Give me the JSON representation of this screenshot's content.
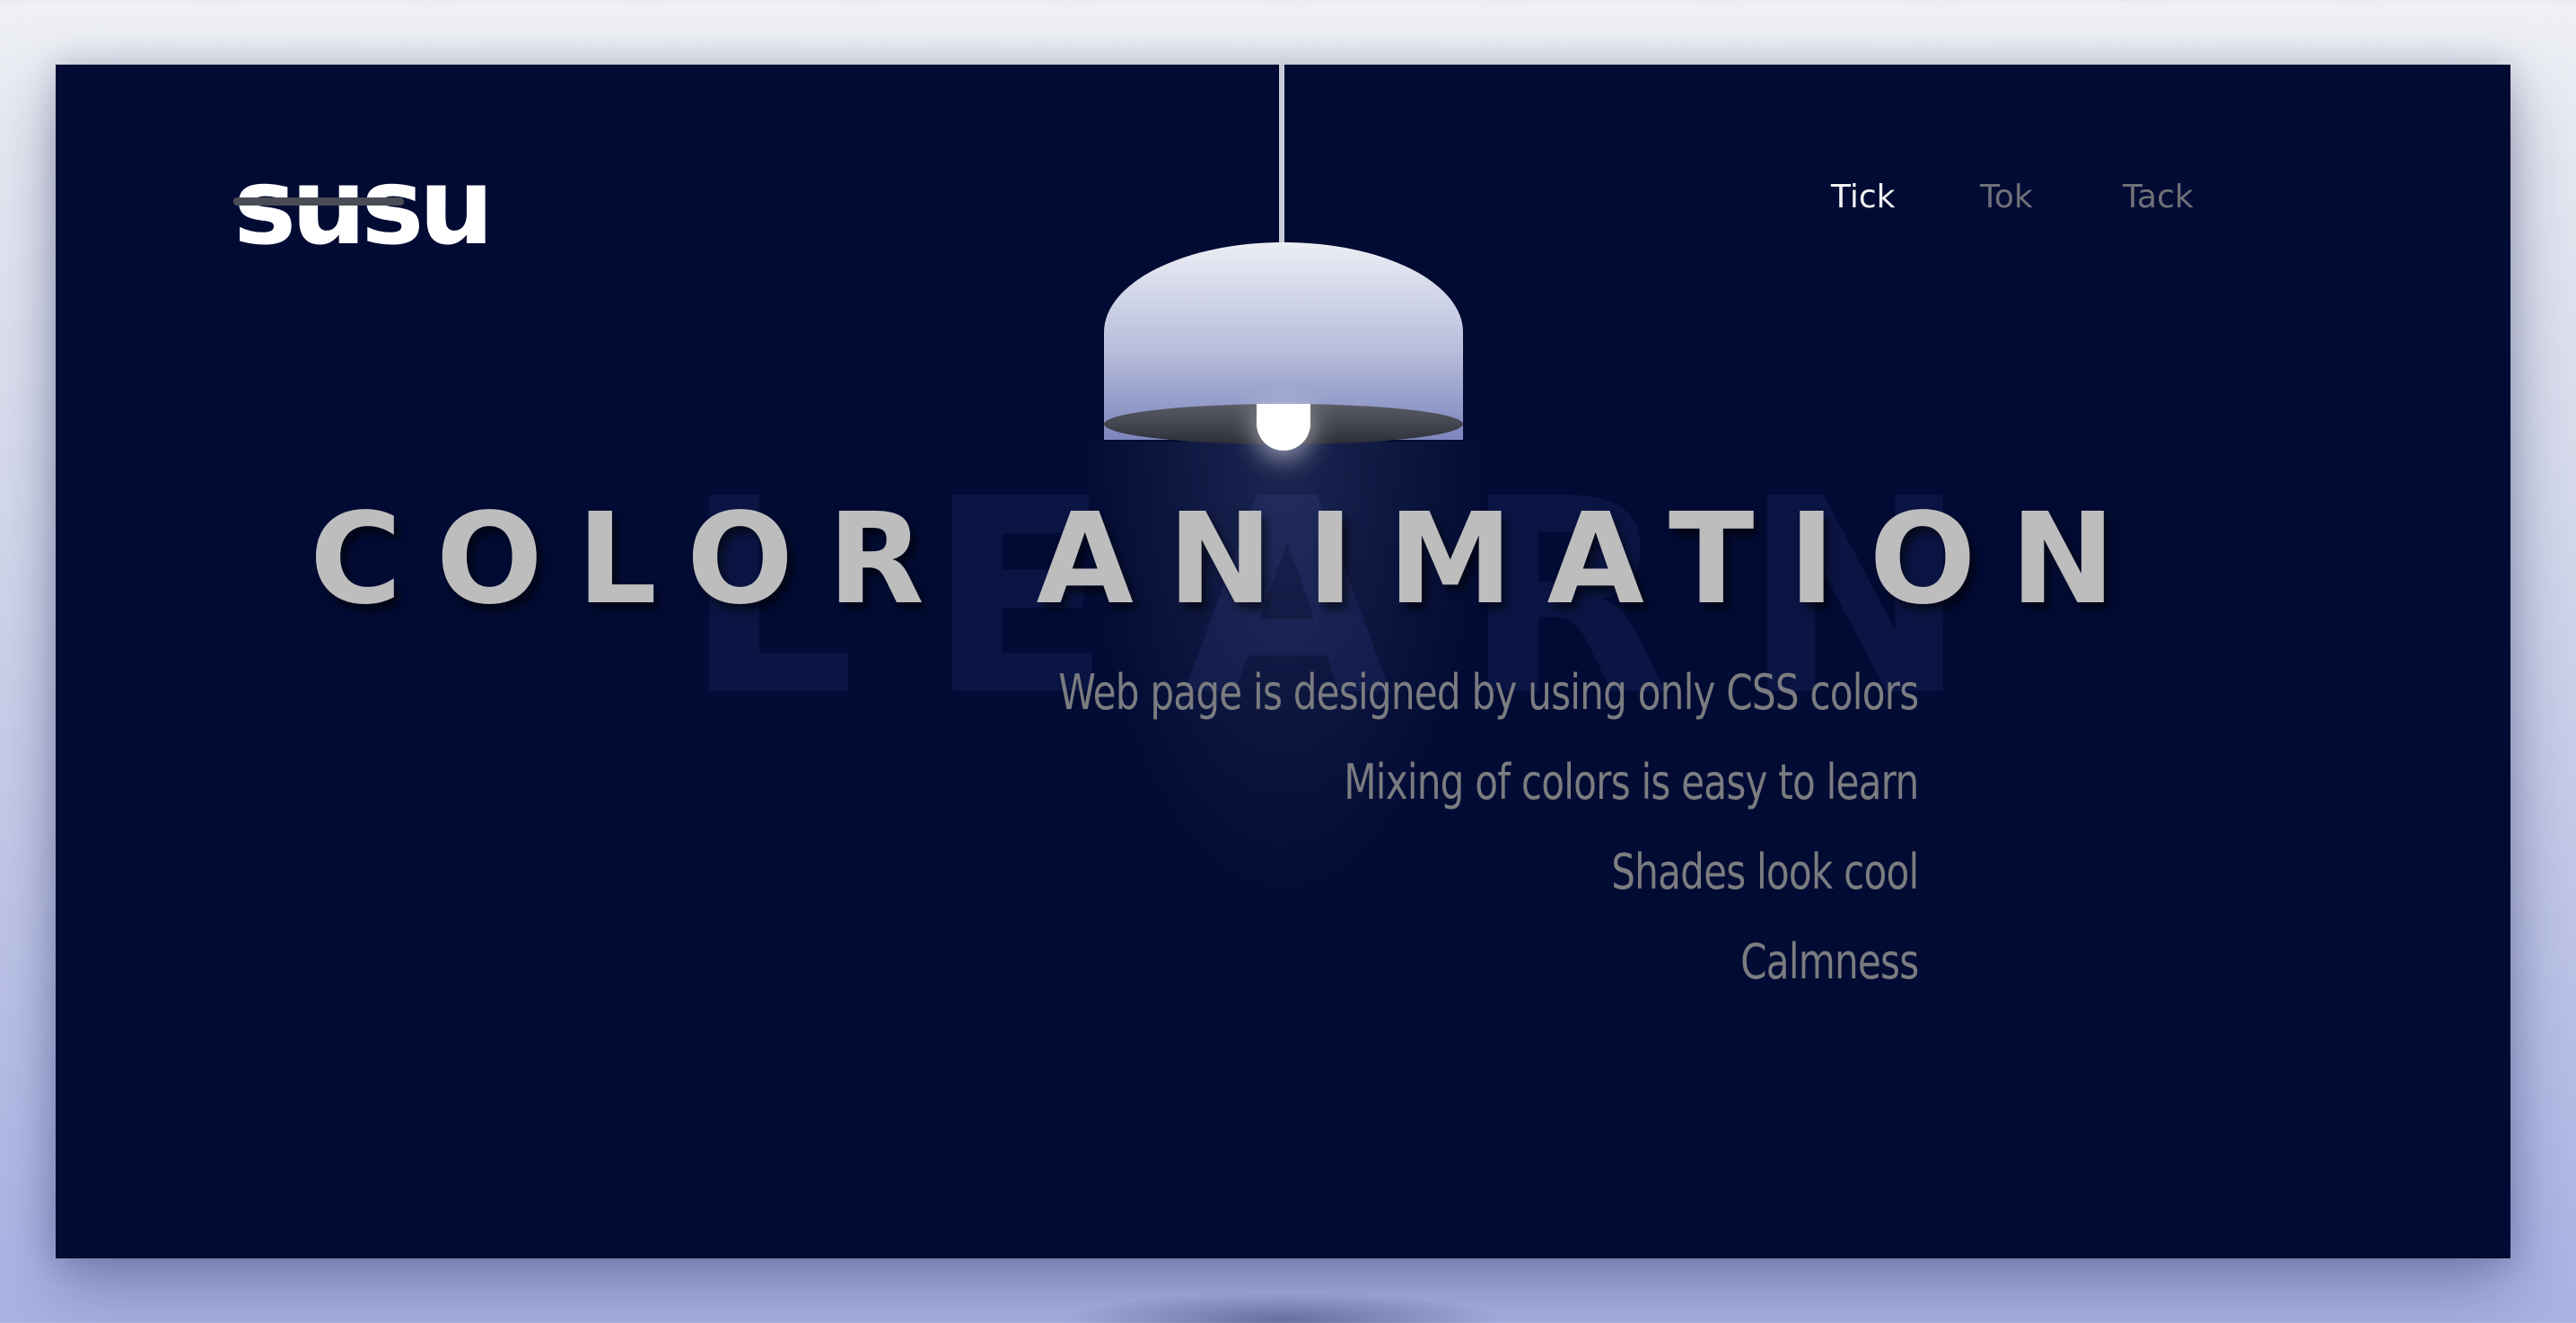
{
  "brand": {
    "logo_text": "susu"
  },
  "nav": {
    "items": [
      {
        "label": "Tick",
        "active": true
      },
      {
        "label": "Tok",
        "active": false
      },
      {
        "label": "Tack",
        "active": false
      }
    ]
  },
  "hero": {
    "title": "COLOR ANIMATION",
    "ghost_text": "LEARN",
    "lines": [
      "Web page is designed by using only CSS colors",
      "Mixing of colors is easy to learn",
      "Shades look cool",
      "Calmness"
    ]
  },
  "colors": {
    "background": "#020b33",
    "page_gradient_top": "#eef0f5",
    "page_gradient_bottom": "#a9b2e4",
    "lamp_shade_top": "#eceef5",
    "lamp_shade_bottom": "#7d86bd",
    "title": "#bdbdbe",
    "body_text": "#7b7c80",
    "nav_active": "#f2f2f4",
    "nav_inactive": "#6f7178"
  }
}
